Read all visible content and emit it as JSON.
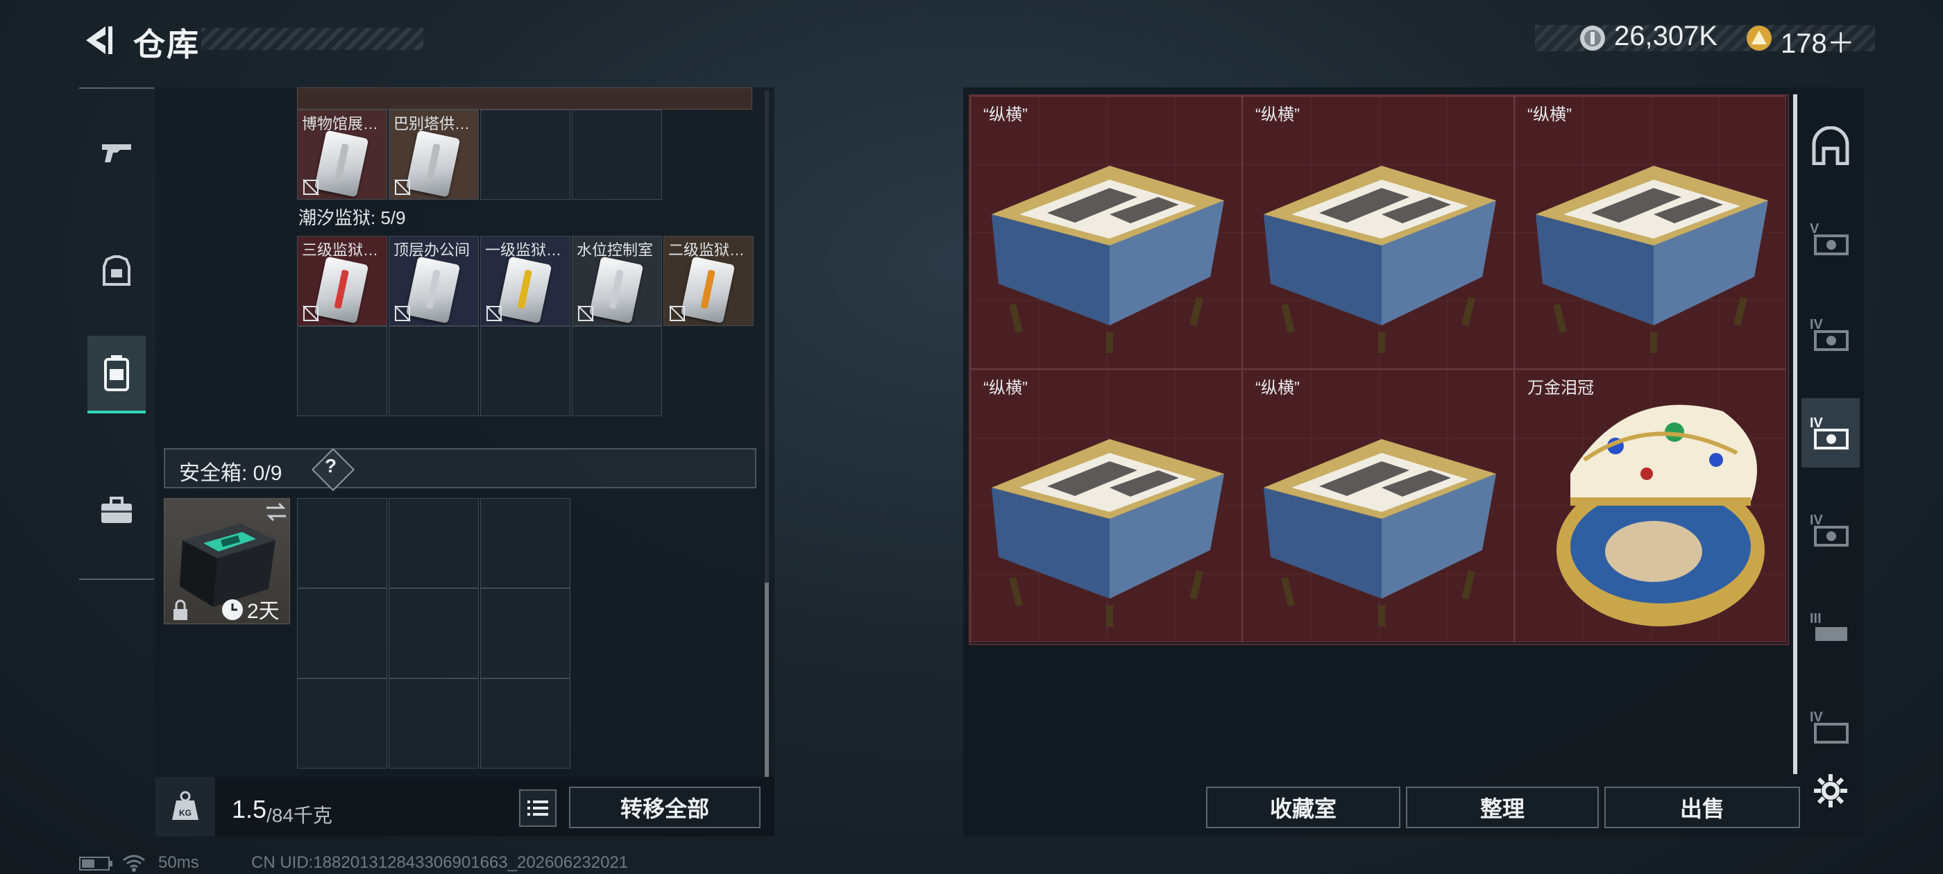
{
  "header": {
    "title": "仓库",
    "currency_1_value": "26,307K",
    "currency_2_value": "178＋"
  },
  "left_panel": {
    "keycards_row_top": [
      {
        "label": "博物馆展…",
        "strip": "#b9bcbf"
      },
      {
        "label": "巴别塔供…",
        "strip": "#b9bcbf"
      }
    ],
    "prison_section": {
      "label": "潮汐监狱: 5/9",
      "cards": [
        {
          "label": "三级监狱…",
          "strip": "#d13c36"
        },
        {
          "label": "顶层办公间",
          "strip": "#c9ccd0"
        },
        {
          "label": "一级监狱…",
          "strip": "#e0b21e"
        },
        {
          "label": "水位控制室",
          "strip": "#c9ccd0"
        },
        {
          "label": "二级监狱…",
          "strip": "#e08a20"
        }
      ]
    },
    "safe_box": {
      "label": "安全箱: 0/9",
      "help": "?",
      "timer": "2天"
    },
    "weight": {
      "current": "1.5",
      "capacity": "/84千克"
    },
    "transfer_all_label": "转移全部"
  },
  "stash": {
    "items": [
      {
        "label": "“纵横”",
        "kind": "chess-box"
      },
      {
        "label": "“纵横”",
        "kind": "chess-box"
      },
      {
        "label": "“纵横”",
        "kind": "chess-box"
      },
      {
        "label": "“纵横”",
        "kind": "chess-box"
      },
      {
        "label": "“纵横”",
        "kind": "chess-box"
      },
      {
        "label": "万金泪冠",
        "kind": "jewel-egg"
      }
    ],
    "buttons": {
      "collection": "收藏室",
      "organize": "整理",
      "sell": "出售"
    }
  },
  "right_tabs": [
    "home-icon",
    "V",
    "IV",
    "IV",
    "IV",
    "III",
    "IV"
  ],
  "status": {
    "ping": "50ms",
    "uid": "CN UID:18820131284330690166​3_202606232021"
  },
  "colors": {
    "accent": "#31d6b5",
    "stash_bg": "#4a1f24"
  }
}
